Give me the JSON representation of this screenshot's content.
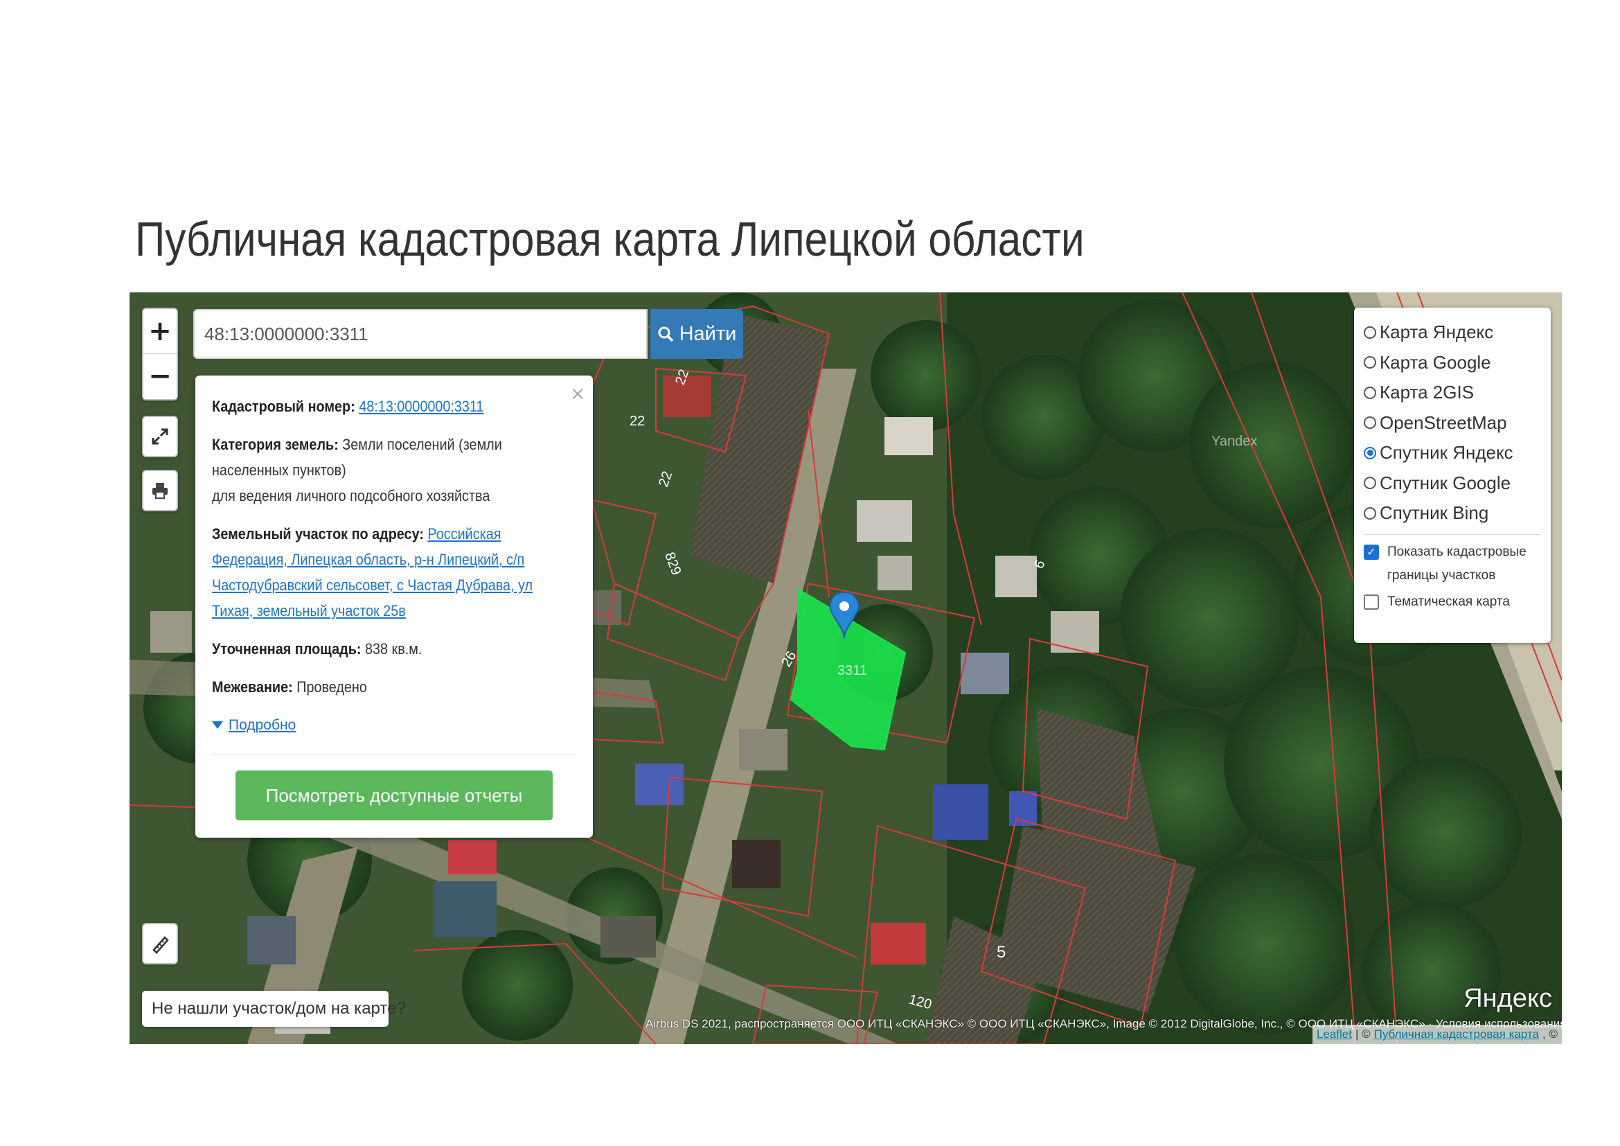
{
  "page": {
    "title": "Публичная кадастровая карта Липецкой области"
  },
  "map": {
    "zoom_in_label": "+",
    "zoom_out_label": "−",
    "search": {
      "value": "48:13:0000000:3311",
      "button_label": "Найти"
    },
    "popup": {
      "cadastral_number_label": "Кадастровый номер:",
      "cadastral_number": "48:13:0000000:3311",
      "land_category_label": "Категория земель:",
      "land_category_value": "Земли поселений (земли населенных пунктов)",
      "land_use": "для ведения личного подсобного хозяйства",
      "address_label": "Земельный участок по адресу:",
      "address_value": "Российская Федерация, Липецкая область, р-н Липецкий, с/п Частодубравский сельсовет, с Частая Дубрава, ул Тихая, земельный участок 25в",
      "area_label": "Уточненная площадь:",
      "area_value": "838 кв.м.",
      "survey_label": "Межевание:",
      "survey_value": "Проведено",
      "more_label": "Подробно",
      "reports_button": "Посмотреть доступные отчеты",
      "close_symbol": "×"
    },
    "layers": {
      "options": [
        {
          "label": "Карта Яндекс",
          "selected": false
        },
        {
          "label": "Карта Google",
          "selected": false
        },
        {
          "label": "Карта 2GIS",
          "selected": false
        },
        {
          "label": "OpenStreetMap",
          "selected": false
        },
        {
          "label": "Спутник Яндекс",
          "selected": true
        },
        {
          "label": "Спутник Google",
          "selected": false
        },
        {
          "label": "Спутник Bing",
          "selected": false
        }
      ],
      "show_boundaries_label": "Показать кадастровые границы участков",
      "show_boundaries_checked": true,
      "thematic_label": "Тематическая карта",
      "thematic_checked": false
    },
    "not_found_button": "Не нашли участок/дом на карте?",
    "attribution": "Airbus DS 2021, распространяется ООО ИТЦ «СКАНЭКС» © ООО ИТЦ «СКАНЭКС», Image © 2012 DigitalGlobe, Inc., © ООО ИТЦ «СКАНЭКС» · Условия использования",
    "leaflet_attribution": {
      "leaflet": "Leaflet",
      "sep": "| ©",
      "site": "Публичная кадастровая карта",
      "tail": ", ©"
    },
    "provider_logo": "Яндекс",
    "watermark": "Yandex",
    "parcel_labels": [
      "22",
      "22",
      "22",
      "829",
      "26",
      "6",
      "5",
      "120",
      "3311"
    ],
    "colors": {
      "parcel_fill": "#19e04a",
      "boundary": "#d83a3a",
      "search_button": "#337ab7",
      "reports_button": "#5cb85c",
      "link": "#1e73c8",
      "radio_selected": "#1a6fd6",
      "marker": "#2a86d6"
    },
    "icons": {
      "search": "magnifier-icon",
      "fullscreen": "expand-arrows-icon",
      "print": "printer-icon",
      "ruler": "ruler-pencil-icon",
      "marker": "map-pin-icon",
      "more": "triangle-down-icon"
    }
  }
}
